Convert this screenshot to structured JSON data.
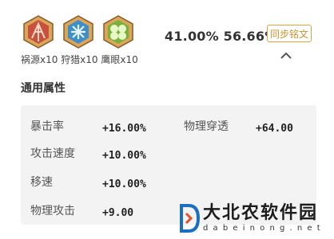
{
  "gems": [
    {
      "name": "red-gem-icon",
      "color": "#c8503c"
    },
    {
      "name": "blue-gem-icon",
      "color": "#3d8ec9"
    },
    {
      "name": "green-gem-icon",
      "color": "#79b23a"
    }
  ],
  "gem_caption": "祸源x10 狩猎x10 鹰眼x10",
  "rates": "41.00% 56.66%",
  "sync_button_label": "同步铭文",
  "section_title": "通用属性",
  "attributes": [
    {
      "name": "暴击率",
      "value": "+16.00%"
    },
    {
      "name": "物理穿透",
      "value": "+64.00"
    },
    {
      "name": "攻击速度",
      "value": "+10.00%"
    },
    {
      "name": "移速",
      "value": "+10.00%"
    },
    {
      "name": "物理攻击",
      "value": "+9.00"
    }
  ],
  "watermark": {
    "text": "大北农软件园",
    "url": "d a b e i n o n g . n e t"
  },
  "colors": {
    "accent_gold": "#d9a441",
    "card_bg": "#f3f3f3"
  }
}
